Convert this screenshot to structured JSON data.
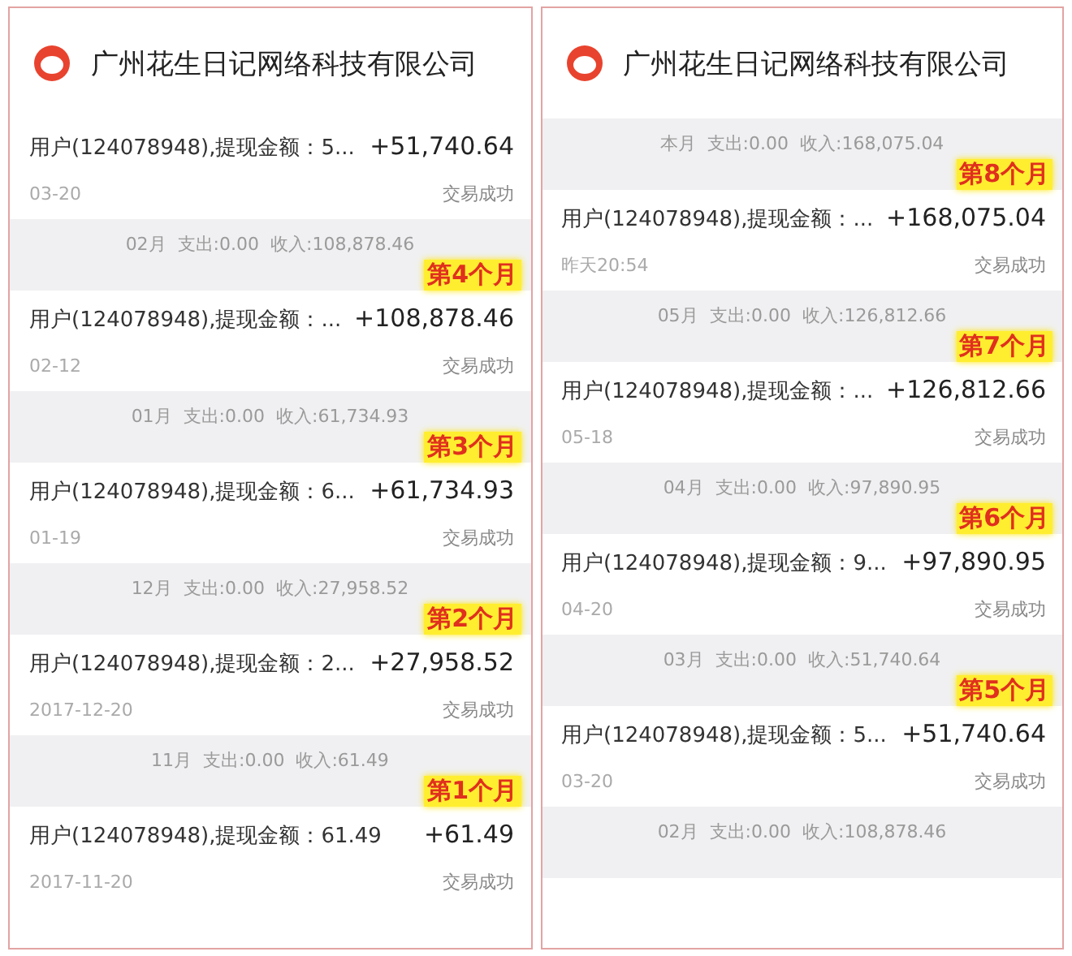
{
  "panels": [
    {
      "title": "广州花生日记网络科技有限公司",
      "items": [
        {
          "kind": "txn",
          "title": "用户(124078948),提现金额：5...",
          "amount": "+51,740.64",
          "date": "03-20",
          "status": "交易成功"
        },
        {
          "kind": "month",
          "text": "02月  支出:0.00  收入:108,878.46",
          "badge": "第4个月"
        },
        {
          "kind": "txn",
          "title": "用户(124078948),提现金额：...",
          "amount": "+108,878.46",
          "date": "02-12",
          "status": "交易成功"
        },
        {
          "kind": "month",
          "text": "01月  支出:0.00  收入:61,734.93",
          "badge": "第3个月"
        },
        {
          "kind": "txn",
          "title": "用户(124078948),提现金额：6...",
          "amount": "+61,734.93",
          "date": "01-19",
          "status": "交易成功"
        },
        {
          "kind": "month",
          "text": "12月  支出:0.00  收入:27,958.52",
          "badge": "第2个月"
        },
        {
          "kind": "txn",
          "title": "用户(124078948),提现金额：2...",
          "amount": "+27,958.52",
          "date": "2017-12-20",
          "status": "交易成功"
        },
        {
          "kind": "month",
          "text": "11月  支出:0.00  收入:61.49",
          "badge": "第1个月"
        },
        {
          "kind": "txn",
          "title": "用户(124078948),提现金额：61.49",
          "amount": "+61.49",
          "date": "2017-11-20",
          "status": "交易成功"
        }
      ]
    },
    {
      "title": "广州花生日记网络科技有限公司",
      "items": [
        {
          "kind": "month",
          "text": "本月  支出:0.00  收入:168,075.04",
          "badge": "第8个月"
        },
        {
          "kind": "txn",
          "title": "用户(124078948),提现金额：...",
          "amount": "+168,075.04",
          "date": "昨天20:54",
          "status": "交易成功"
        },
        {
          "kind": "month",
          "text": "05月  支出:0.00  收入:126,812.66",
          "badge": "第7个月"
        },
        {
          "kind": "txn",
          "title": "用户(124078948),提现金额：...",
          "amount": "+126,812.66",
          "date": "05-18",
          "status": "交易成功"
        },
        {
          "kind": "month",
          "text": "04月  支出:0.00  收入:97,890.95",
          "badge": "第6个月"
        },
        {
          "kind": "txn",
          "title": "用户(124078948),提现金额：9...",
          "amount": "+97,890.95",
          "date": "04-20",
          "status": "交易成功"
        },
        {
          "kind": "month",
          "text": "03月  支出:0.00  收入:51,740.64",
          "badge": "第5个月"
        },
        {
          "kind": "txn",
          "title": "用户(124078948),提现金额：5...",
          "amount": "+51,740.64",
          "date": "03-20",
          "status": "交易成功"
        },
        {
          "kind": "month",
          "text": "02月  支出:0.00  收入:108,878.46"
        }
      ]
    }
  ]
}
